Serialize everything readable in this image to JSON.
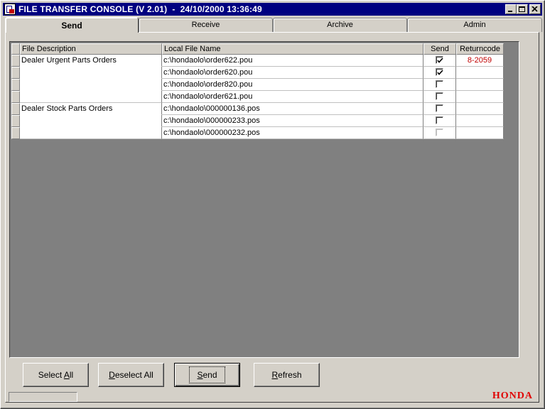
{
  "window": {
    "title": "FILE TRANSFER CONSOLE (V 2.01)  -  24/10/2000 13:36:49",
    "icon": "app-icon"
  },
  "tabs": [
    {
      "label": "Send",
      "active": true
    },
    {
      "label": "Receive",
      "active": false
    },
    {
      "label": "Archive",
      "active": false
    },
    {
      "label": "Admin",
      "active": false
    }
  ],
  "grid": {
    "headers": [
      "File Description",
      "Local File Name",
      "Send",
      "Returncode"
    ],
    "rows": [
      {
        "description": "Dealer Urgent Parts Orders",
        "file": "c:\\hondaolo\\order622.pou",
        "send": true,
        "returncode": "8-2059"
      },
      {
        "description": "",
        "file": "c:\\hondaolo\\order620.pou",
        "send": true,
        "returncode": ""
      },
      {
        "description": "",
        "file": "c:\\hondaolo\\order820.pou",
        "send": false,
        "returncode": ""
      },
      {
        "description": "",
        "file": "c:\\hondaolo\\order621.pou",
        "send": false,
        "returncode": ""
      },
      {
        "description": "Dealer Stock Parts Orders",
        "file": "c:\\hondaolo\\000000136.pos",
        "send": false,
        "returncode": ""
      },
      {
        "description": "",
        "file": "c:\\hondaolo\\000000233.pos",
        "send": false,
        "returncode": ""
      },
      {
        "description": "",
        "file": "c:\\hondaolo\\000000232.pos",
        "send": false,
        "returncode": ""
      }
    ]
  },
  "buttons": {
    "select_all": {
      "pre": "Select ",
      "accel": "A",
      "post": "ll"
    },
    "deselect_all": {
      "pre": "",
      "accel": "D",
      "post": "eselect All"
    },
    "send": {
      "pre": "",
      "accel": "S",
      "post": "end"
    },
    "refresh": {
      "pre": "",
      "accel": "R",
      "post": "efresh"
    }
  },
  "brand": "HONDA",
  "colors": {
    "titlebar": "#000080",
    "returncode_error": "#c00000",
    "brand": "#e00000"
  }
}
